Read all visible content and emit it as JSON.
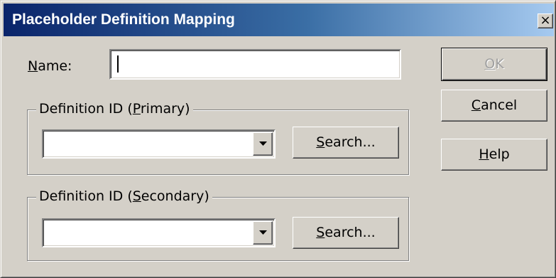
{
  "dialog": {
    "title": "Placeholder Definition Mapping",
    "close_label": "×"
  },
  "name_field": {
    "label_accel": "N",
    "label_rest": "ame:",
    "value": ""
  },
  "primary_group": {
    "legend_prefix": "Definition ID (",
    "legend_accel": "P",
    "legend_suffix": "rimary)",
    "combo_value": "",
    "search_accel": "S",
    "search_rest": "earch..."
  },
  "secondary_group": {
    "legend_prefix": "Definition ID (",
    "legend_accel": "S",
    "legend_suffix": "econdary)",
    "combo_value": "",
    "search_accel": "S",
    "search_rest": "earch..."
  },
  "buttons": {
    "ok_accel": "O",
    "ok_rest": "K",
    "ok_enabled": false,
    "cancel_accel": "C",
    "cancel_rest": "ancel",
    "help_accel": "H",
    "help_rest": "elp"
  }
}
